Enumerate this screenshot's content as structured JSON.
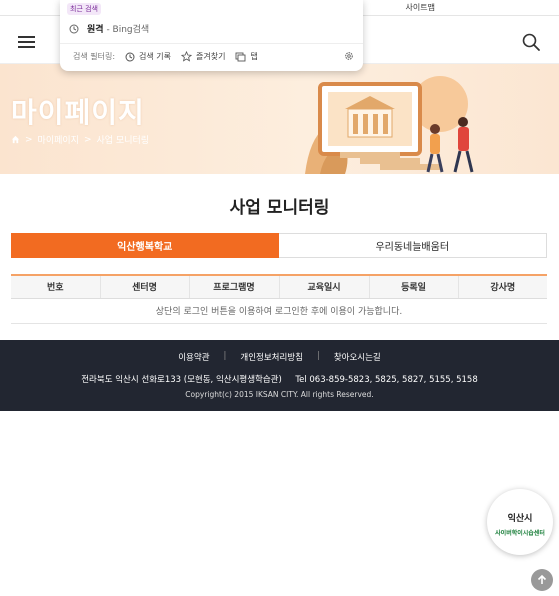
{
  "topbar": {
    "sitemap_label": "사이트맵"
  },
  "header": {
    "menu_icon": "hamburger-menu-icon",
    "search_icon": "search-icon"
  },
  "search_popup": {
    "recent_label": "최근 검색",
    "recent_query": "원격",
    "recent_source": "- Bing검색",
    "filter_label": "검색 필터링:",
    "filter_history": "검색 기록",
    "filter_favorites": "즐겨찾기",
    "filter_tabs": "탭"
  },
  "hero": {
    "title": "마이페이지",
    "breadcrumb": [
      "마이페이지",
      "사업 모니터링"
    ]
  },
  "main": {
    "title": "사업 모니터링",
    "tabs": [
      {
        "label": "익산행복학교",
        "active": true
      },
      {
        "label": "우리동네늘배움터",
        "active": false
      }
    ],
    "table": {
      "headers": [
        "번호",
        "센터명",
        "프로그램명",
        "교육일시",
        "등록일",
        "강사명"
      ],
      "empty_message": "상단의 로그인 버튼을 이용하여 로그인한 후에 이용이 가능합니다."
    }
  },
  "footer": {
    "links": [
      "이용약관",
      "개인정보처리방침",
      "찾아오시는길"
    ],
    "address": "전라북도 익산시 선화로133 (모현동, 익산시평생학습관)",
    "tel": "Tel 063-859-5823, 5825, 5827, 5155, 5158",
    "copyright": "Copyright(c) 2015 IKSAN CITY. All rights Reserved."
  },
  "floating_badge": {
    "line1": "익산시",
    "line2": "사이버학이시습센터"
  },
  "colors": {
    "accent": "#f26b21",
    "footer_bg": "#222631",
    "hero_bg": "#fbe4cf"
  }
}
